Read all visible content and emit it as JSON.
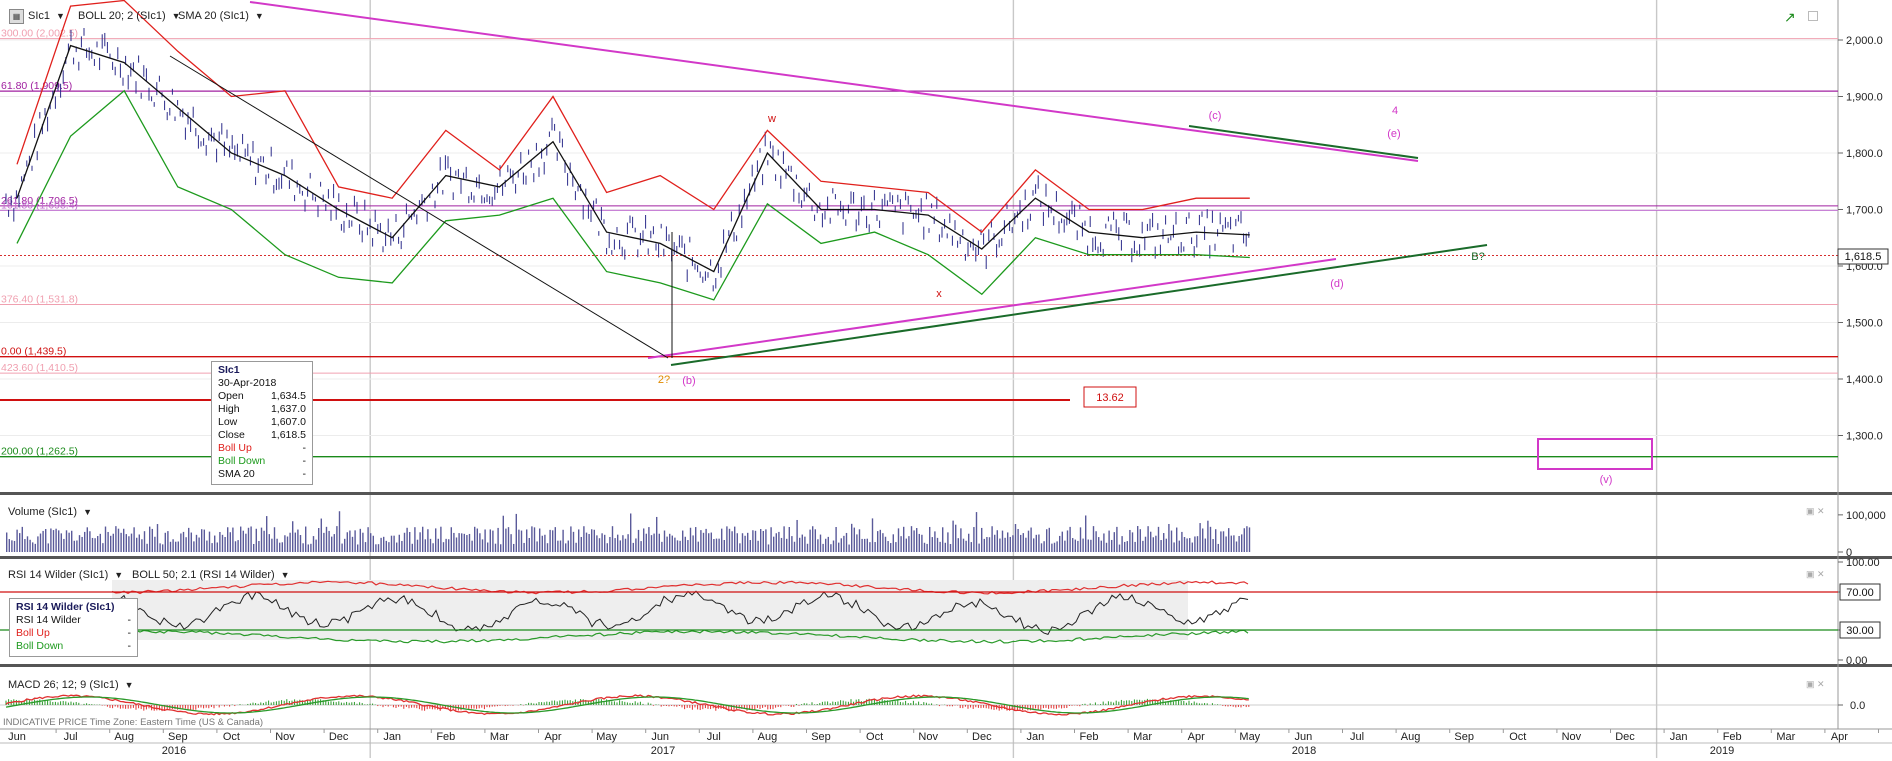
{
  "header": {
    "main_instrument": "SIc1",
    "boll_label": "BOLL 20; 2 (SIc1)",
    "sma_label": "SMA 20 (SIc1)",
    "volume_label": "Volume (SIc1)",
    "rsi_label": "RSI 14 Wilder (SIc1)",
    "rsi_boll_label": "BOLL 50; 2.1 (RSI 14 Wilder)",
    "macd_label": "MACD 26; 12; 9 (SIc1)",
    "footer_note": "INDICATIVE PRICE   Time Zone: Eastern Time (US & Canada)"
  },
  "tooltip_price": {
    "title": "SIc1",
    "date": "30-Apr-2018",
    "rows": [
      {
        "label": "Open",
        "value": "1,634.5"
      },
      {
        "label": "High",
        "value": "1,637.0"
      },
      {
        "label": "Low",
        "value": "1,607.0"
      },
      {
        "label": "Close",
        "value": "1,618.5"
      },
      {
        "label": "Boll Up",
        "value": "-"
      },
      {
        "label": "Boll Down",
        "value": "-"
      },
      {
        "label": "SMA 20",
        "value": "-"
      }
    ]
  },
  "tooltip_rsi": {
    "title": "RSI 14 Wilder (SIc1)",
    "rows": [
      {
        "label": "RSI 14 Wilder",
        "value": "-"
      },
      {
        "label": "Boll Up",
        "value": "-"
      },
      {
        "label": "Boll Down",
        "value": "-"
      }
    ]
  },
  "colors": {
    "price_bars": "#2b2b8a",
    "boll_up": "#e0201c",
    "boll_down": "#1d9a1d",
    "sma": "#111111",
    "trend_magenta": "#d238c8",
    "trend_green": "#1a6b2a",
    "fib_purple": "#a020a0",
    "fib_red": "#d01010",
    "fib_green": "#1a8a1a",
    "fib_pink": "#f0a0b0",
    "macd_red": "#e03030",
    "macd_green": "#2a9a2a"
  },
  "chart_data": [
    {
      "type": "line",
      "panel": "price",
      "instrument": "SIc1",
      "y_axis": {
        "ticks": [
          "2,000.0",
          "1,900.0",
          "1,800.0",
          "1,700.0",
          "1,600.0",
          "1,500.0",
          "1,400.0",
          "1,300.0"
        ],
        "range": [
          1200,
          2060
        ]
      },
      "last_price_label": "1,618.5",
      "x_axis": {
        "month_ticks": [
          "Jun",
          "Jul",
          "Aug",
          "Sep",
          "Oct",
          "Nov",
          "Dec",
          "Jan",
          "Feb",
          "Mar",
          "Apr",
          "May",
          "Jun",
          "Jul",
          "Aug",
          "Sep",
          "Oct",
          "Nov",
          "Dec",
          "Jan",
          "Feb",
          "Mar",
          "Apr",
          "May",
          "Jun",
          "Jul",
          "Aug",
          "Sep",
          "Oct",
          "Nov",
          "Dec",
          "Jan",
          "Feb",
          "Mar",
          "Apr"
        ],
        "year_labels": [
          "2016",
          "2017",
          "2018",
          "2019"
        ],
        "range": [
          "2015-06",
          "2019-04"
        ]
      },
      "series": [
        {
          "name": "SMA 20",
          "x": [
            "2015-06",
            "2015-07",
            "2015-08",
            "2015-09",
            "2015-10",
            "2015-11",
            "2015-12",
            "2016-01",
            "2016-02",
            "2016-03",
            "2016-04",
            "2016-05",
            "2016-06",
            "2016-07",
            "2016-08",
            "2016-09",
            "2016-10",
            "2016-11",
            "2016-12",
            "2017-01",
            "2017-02",
            "2017-03",
            "2017-04",
            "2017-05"
          ],
          "values": [
            1720,
            1990,
            1960,
            1880,
            1800,
            1760,
            1700,
            1650,
            1760,
            1740,
            1820,
            1660,
            1640,
            1590,
            1800,
            1700,
            1700,
            1690,
            1630,
            1720,
            1660,
            1650,
            1660,
            1655
          ]
        },
        {
          "name": "Boll Up",
          "x": [
            "2015-06",
            "2015-07",
            "2015-08",
            "2015-09",
            "2015-10",
            "2015-11",
            "2015-12",
            "2016-01",
            "2016-02",
            "2016-03",
            "2016-04",
            "2016-05",
            "2016-06",
            "2016-07",
            "2016-08",
            "2016-09",
            "2016-10",
            "2016-11",
            "2016-12",
            "2017-01",
            "2017-02",
            "2017-03",
            "2017-04",
            "2017-05"
          ],
          "values": [
            1780,
            2060,
            2070,
            1980,
            1900,
            1910,
            1740,
            1720,
            1840,
            1770,
            1900,
            1730,
            1760,
            1700,
            1840,
            1750,
            1740,
            1730,
            1660,
            1770,
            1700,
            1700,
            1720,
            1720
          ]
        },
        {
          "name": "Boll Down",
          "x": [
            "2015-06",
            "2015-07",
            "2015-08",
            "2015-09",
            "2015-10",
            "2015-11",
            "2015-12",
            "2016-01",
            "2016-02",
            "2016-03",
            "2016-04",
            "2016-05",
            "2016-06",
            "2016-07",
            "2016-08",
            "2016-09",
            "2016-10",
            "2016-11",
            "2016-12",
            "2017-01",
            "2017-02",
            "2017-03",
            "2017-04",
            "2017-05"
          ],
          "values": [
            1640,
            1830,
            1910,
            1740,
            1700,
            1620,
            1580,
            1570,
            1680,
            1690,
            1720,
            1590,
            1570,
            1540,
            1710,
            1640,
            1660,
            1620,
            1550,
            1650,
            1620,
            1620,
            1620,
            1615
          ]
        }
      ],
      "fib_levels": [
        {
          "label": "300.00 (2,002.5)",
          "value": 2002.5
        },
        {
          "label": "61.80 (1,909.5)",
          "value": 1909.5
        },
        {
          "label": "261.80 (1,706.5)",
          "value": 1706.5
        },
        {
          "label": "161.80 (1,698.4)",
          "value": 1698.4
        },
        {
          "label": "376.40 (1,531.8)",
          "value": 1531.8
        },
        {
          "label": "0.00 (1,439.5)",
          "value": 1439.5
        },
        {
          "label": "423.60 (1,410.5)",
          "value": 1410.5
        },
        {
          "label": "200.00 (1,262.5)",
          "value": 1262.5
        }
      ],
      "annotations": [
        "w",
        "x",
        "(c)",
        "4",
        "(e)",
        "(d)",
        "B?",
        "2?",
        "(b)",
        "(v)",
        "13.62"
      ]
    },
    {
      "type": "bar",
      "panel": "volume",
      "name": "Volume (SIc1)",
      "y_axis": {
        "ticks": [
          "100,000",
          "0"
        ],
        "range": [
          0,
          140000
        ]
      }
    },
    {
      "type": "line",
      "panel": "rsi",
      "name": "RSI 14 Wilder (SIc1)",
      "y_axis": {
        "ticks": [
          "100.00",
          "70.00",
          "30.00",
          "0.00"
        ],
        "range": [
          0,
          100
        ]
      },
      "levels": [
        70,
        30
      ]
    },
    {
      "type": "line",
      "panel": "macd",
      "name": "MACD 26; 12; 9 (SIc1)",
      "y_axis": {
        "ticks": [
          "0.0"
        ]
      }
    }
  ]
}
